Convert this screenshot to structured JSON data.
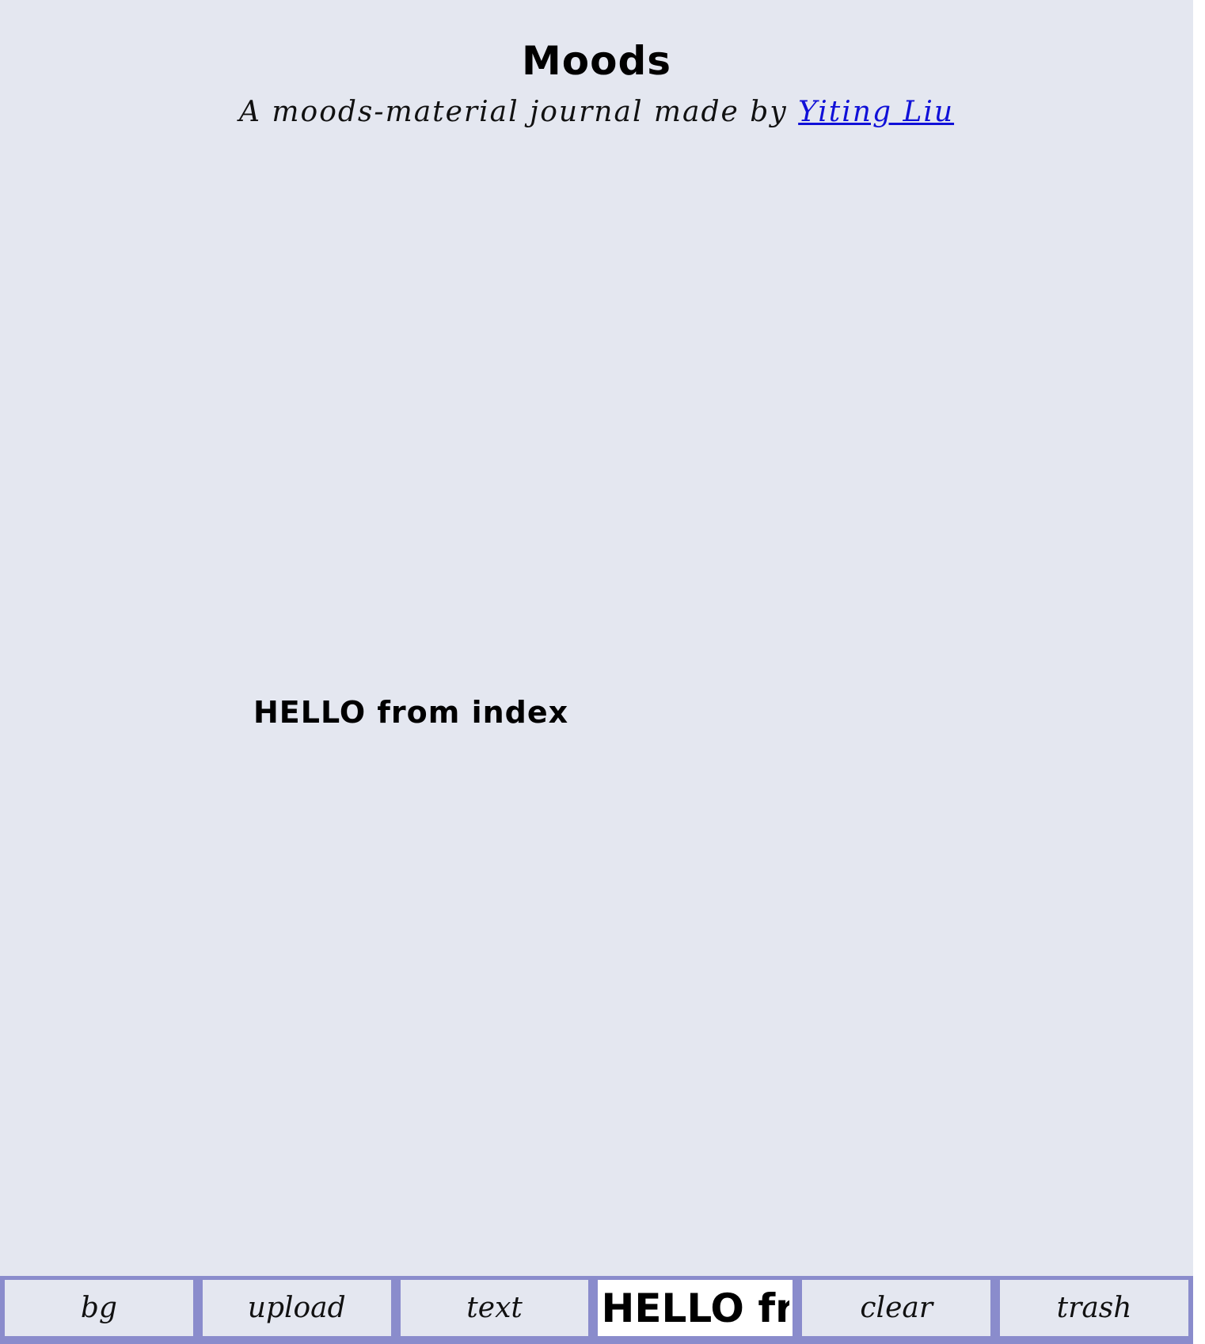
{
  "header": {
    "title": "Moods",
    "subtitle_prefix": "A moods-material journal made by ",
    "author_link": "Yiting Liu"
  },
  "canvas": {
    "text_item": "HELLO from index"
  },
  "toolbar": {
    "bg_label": "bg",
    "upload_label": "upload",
    "text_label": "text",
    "text_input_value": "HELLO from index",
    "clear_label": "clear",
    "trash_label": "trash"
  },
  "colors": {
    "background": "#e4e7f0",
    "toolbar": "#8a8ccc",
    "link": "#1010d8"
  }
}
